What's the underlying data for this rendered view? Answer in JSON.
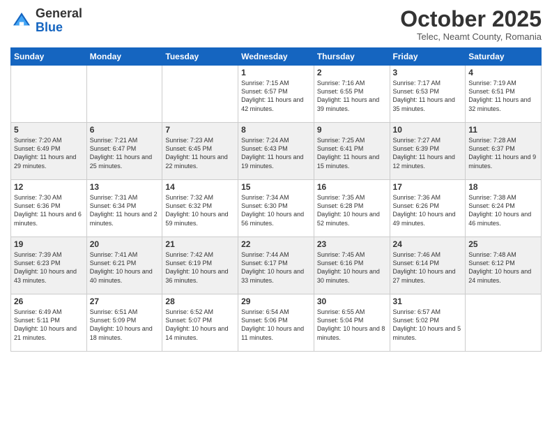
{
  "header": {
    "logo_general": "General",
    "logo_blue": "Blue",
    "month": "October 2025",
    "location": "Telec, Neamt County, Romania"
  },
  "weekdays": [
    "Sunday",
    "Monday",
    "Tuesday",
    "Wednesday",
    "Thursday",
    "Friday",
    "Saturday"
  ],
  "weeks": [
    [
      {
        "day": "",
        "info": ""
      },
      {
        "day": "",
        "info": ""
      },
      {
        "day": "",
        "info": ""
      },
      {
        "day": "1",
        "info": "Sunrise: 7:15 AM\nSunset: 6:57 PM\nDaylight: 11 hours and 42 minutes."
      },
      {
        "day": "2",
        "info": "Sunrise: 7:16 AM\nSunset: 6:55 PM\nDaylight: 11 hours and 39 minutes."
      },
      {
        "day": "3",
        "info": "Sunrise: 7:17 AM\nSunset: 6:53 PM\nDaylight: 11 hours and 35 minutes."
      },
      {
        "day": "4",
        "info": "Sunrise: 7:19 AM\nSunset: 6:51 PM\nDaylight: 11 hours and 32 minutes."
      }
    ],
    [
      {
        "day": "5",
        "info": "Sunrise: 7:20 AM\nSunset: 6:49 PM\nDaylight: 11 hours and 29 minutes."
      },
      {
        "day": "6",
        "info": "Sunrise: 7:21 AM\nSunset: 6:47 PM\nDaylight: 11 hours and 25 minutes."
      },
      {
        "day": "7",
        "info": "Sunrise: 7:23 AM\nSunset: 6:45 PM\nDaylight: 11 hours and 22 minutes."
      },
      {
        "day": "8",
        "info": "Sunrise: 7:24 AM\nSunset: 6:43 PM\nDaylight: 11 hours and 19 minutes."
      },
      {
        "day": "9",
        "info": "Sunrise: 7:25 AM\nSunset: 6:41 PM\nDaylight: 11 hours and 15 minutes."
      },
      {
        "day": "10",
        "info": "Sunrise: 7:27 AM\nSunset: 6:39 PM\nDaylight: 11 hours and 12 minutes."
      },
      {
        "day": "11",
        "info": "Sunrise: 7:28 AM\nSunset: 6:37 PM\nDaylight: 11 hours and 9 minutes."
      }
    ],
    [
      {
        "day": "12",
        "info": "Sunrise: 7:30 AM\nSunset: 6:36 PM\nDaylight: 11 hours and 6 minutes."
      },
      {
        "day": "13",
        "info": "Sunrise: 7:31 AM\nSunset: 6:34 PM\nDaylight: 11 hours and 2 minutes."
      },
      {
        "day": "14",
        "info": "Sunrise: 7:32 AM\nSunset: 6:32 PM\nDaylight: 10 hours and 59 minutes."
      },
      {
        "day": "15",
        "info": "Sunrise: 7:34 AM\nSunset: 6:30 PM\nDaylight: 10 hours and 56 minutes."
      },
      {
        "day": "16",
        "info": "Sunrise: 7:35 AM\nSunset: 6:28 PM\nDaylight: 10 hours and 52 minutes."
      },
      {
        "day": "17",
        "info": "Sunrise: 7:36 AM\nSunset: 6:26 PM\nDaylight: 10 hours and 49 minutes."
      },
      {
        "day": "18",
        "info": "Sunrise: 7:38 AM\nSunset: 6:24 PM\nDaylight: 10 hours and 46 minutes."
      }
    ],
    [
      {
        "day": "19",
        "info": "Sunrise: 7:39 AM\nSunset: 6:23 PM\nDaylight: 10 hours and 43 minutes."
      },
      {
        "day": "20",
        "info": "Sunrise: 7:41 AM\nSunset: 6:21 PM\nDaylight: 10 hours and 40 minutes."
      },
      {
        "day": "21",
        "info": "Sunrise: 7:42 AM\nSunset: 6:19 PM\nDaylight: 10 hours and 36 minutes."
      },
      {
        "day": "22",
        "info": "Sunrise: 7:44 AM\nSunset: 6:17 PM\nDaylight: 10 hours and 33 minutes."
      },
      {
        "day": "23",
        "info": "Sunrise: 7:45 AM\nSunset: 6:16 PM\nDaylight: 10 hours and 30 minutes."
      },
      {
        "day": "24",
        "info": "Sunrise: 7:46 AM\nSunset: 6:14 PM\nDaylight: 10 hours and 27 minutes."
      },
      {
        "day": "25",
        "info": "Sunrise: 7:48 AM\nSunset: 6:12 PM\nDaylight: 10 hours and 24 minutes."
      }
    ],
    [
      {
        "day": "26",
        "info": "Sunrise: 6:49 AM\nSunset: 5:11 PM\nDaylight: 10 hours and 21 minutes."
      },
      {
        "day": "27",
        "info": "Sunrise: 6:51 AM\nSunset: 5:09 PM\nDaylight: 10 hours and 18 minutes."
      },
      {
        "day": "28",
        "info": "Sunrise: 6:52 AM\nSunset: 5:07 PM\nDaylight: 10 hours and 14 minutes."
      },
      {
        "day": "29",
        "info": "Sunrise: 6:54 AM\nSunset: 5:06 PM\nDaylight: 10 hours and 11 minutes."
      },
      {
        "day": "30",
        "info": "Sunrise: 6:55 AM\nSunset: 5:04 PM\nDaylight: 10 hours and 8 minutes."
      },
      {
        "day": "31",
        "info": "Sunrise: 6:57 AM\nSunset: 5:02 PM\nDaylight: 10 hours and 5 minutes."
      },
      {
        "day": "",
        "info": ""
      }
    ]
  ]
}
